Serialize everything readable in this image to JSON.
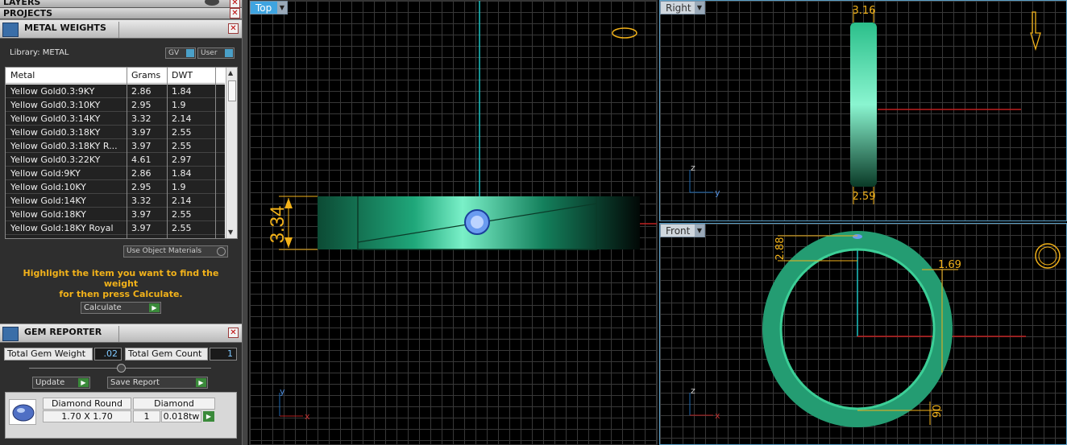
{
  "colors": {
    "accent": "#f2b21a",
    "viewport_bg": "#000000",
    "ring": "#2aa57a",
    "dim": "#f2b21a"
  },
  "layers": {
    "title": "LAYERS"
  },
  "projects": {
    "title": "PROJECTS"
  },
  "metal_weights": {
    "title": "METAL WEIGHTS",
    "library_label": "Library: METAL",
    "gv_button": "GV",
    "user_button": "User",
    "columns": [
      "Metal",
      "Grams",
      "DWT"
    ],
    "rows": [
      {
        "metal": "Yellow Gold0.3:9KY",
        "grams": "2.86",
        "dwt": "1.84"
      },
      {
        "metal": "Yellow Gold0.3:10KY",
        "grams": "2.95",
        "dwt": "1.9"
      },
      {
        "metal": "Yellow Gold0.3:14KY",
        "grams": "3.32",
        "dwt": "2.14"
      },
      {
        "metal": "Yellow Gold0.3:18KY",
        "grams": "3.97",
        "dwt": "2.55"
      },
      {
        "metal": "Yellow Gold0.3:18KY R...",
        "grams": "3.97",
        "dwt": "2.55"
      },
      {
        "metal": "Yellow Gold0.3:22KY",
        "grams": "4.61",
        "dwt": "2.97"
      },
      {
        "metal": "Yellow Gold:9KY",
        "grams": "2.86",
        "dwt": "1.84"
      },
      {
        "metal": "Yellow Gold:10KY",
        "grams": "2.95",
        "dwt": "1.9"
      },
      {
        "metal": "Yellow Gold:14KY",
        "grams": "3.32",
        "dwt": "2.14"
      },
      {
        "metal": "Yellow Gold:18KY",
        "grams": "3.97",
        "dwt": "2.55"
      },
      {
        "metal": "Yellow Gold:18KY Royal",
        "grams": "3.97",
        "dwt": "2.55"
      }
    ],
    "use_object_materials": "Use Object Materials",
    "hint_line1": "Highlight the item you want to find the weight",
    "hint_line2": "for then press Calculate.",
    "calculate_button": "Calculate"
  },
  "gem_reporter": {
    "title": "GEM REPORTER",
    "total_weight_label": "Total Gem Weight",
    "total_weight_value": ".02",
    "total_count_label": "Total Gem Count",
    "total_count_value": "1",
    "update_button": "Update",
    "save_report_button": "Save Report",
    "gem": {
      "shape": "Diamond Round",
      "size": "1.70 X 1.70",
      "material": "Diamond",
      "count": "1",
      "weight": "0.018tw"
    }
  },
  "viewports": {
    "top": {
      "label": "Top",
      "dim": "3.34"
    },
    "right": {
      "label": "Right",
      "dim_top": "3.16",
      "dim_bottom": "2.59",
      "axis_v": "z",
      "axis_h": "y"
    },
    "front": {
      "label": "Front",
      "dim_left": "2.88",
      "dim_right": "1.69",
      "dim_bottom": "90",
      "axis_v": "z",
      "axis_h": "x"
    },
    "top_axes": {
      "v": "y",
      "h": "x"
    }
  }
}
